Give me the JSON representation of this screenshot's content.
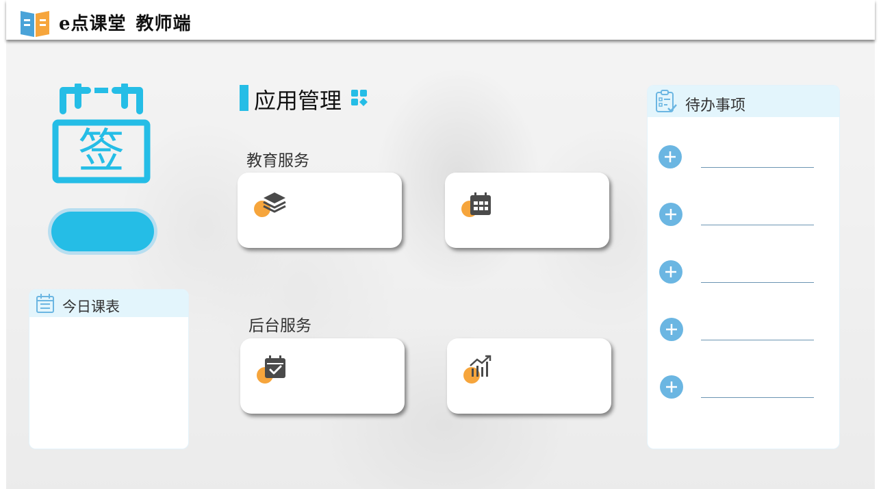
{
  "app": {
    "name": "e点课堂",
    "role": "教师端"
  },
  "signin": {
    "icon_char": "签"
  },
  "schedule": {
    "title": "今日课表"
  },
  "apps": {
    "title": "应用管理",
    "groups": [
      {
        "label": "教育服务",
        "cards": [
          {
            "icon": "layers-icon"
          },
          {
            "icon": "calendar-grid-icon"
          }
        ]
      },
      {
        "label": "后台服务",
        "cards": [
          {
            "icon": "calendar-check-icon"
          },
          {
            "icon": "chart-growth-icon"
          }
        ]
      }
    ]
  },
  "todo": {
    "title": "待办事项",
    "item_count": 5
  },
  "colors": {
    "accent": "#25bde6",
    "orange": "#f6a53c",
    "icon_dark": "#4a4a4a",
    "add_button": "#6bb6e2"
  }
}
